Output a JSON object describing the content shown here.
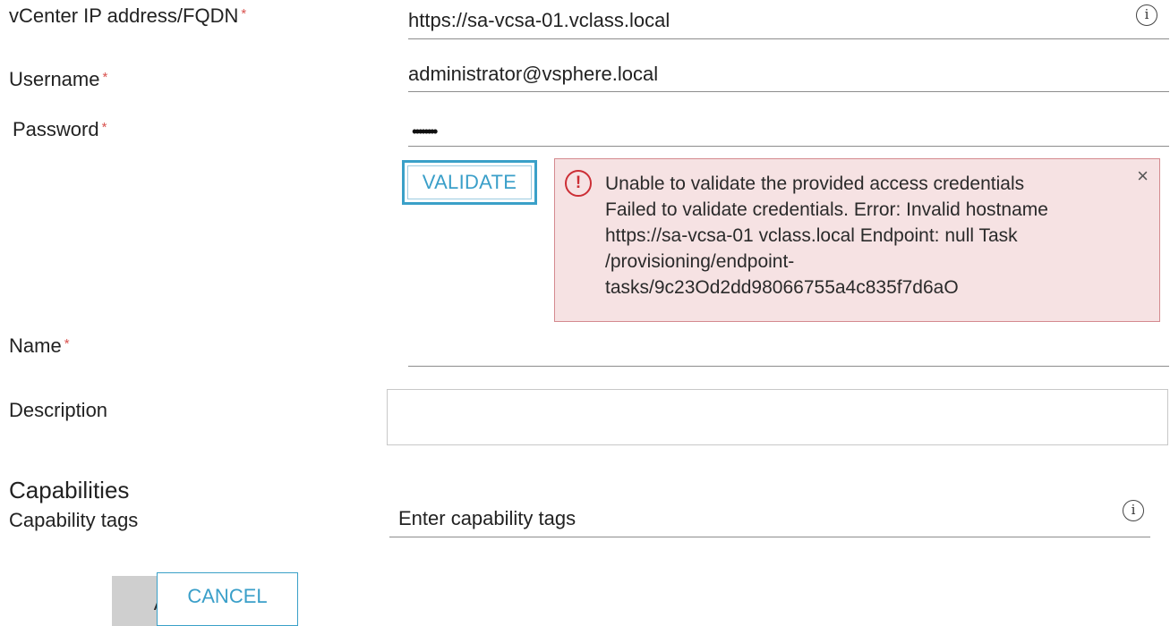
{
  "form": {
    "vcenter": {
      "label": "vCenter IP address/FQDN",
      "required_mark": "*",
      "value": "https://sa-vcsa-01.vclass.local",
      "info_icon": "info-icon"
    },
    "username": {
      "label": "Username",
      "required_mark": "*",
      "value": "administrator@vsphere.local"
    },
    "password": {
      "label": "Password",
      "required_mark": "*",
      "masked_value": "••••••••"
    },
    "validate_label": "VALIDATE",
    "alert": {
      "icon": "exclamation-icon",
      "lines": [
        "Unable to validate the provided access credentials",
        "Failed to validate credentials. Error: Invalid hostname",
        "https://sa-vcsa-01 vclass.local Endpoint: null Task",
        "/provisioning/endpoint-",
        "tasks/9c23Od2dd98066755a4c835f7d6aO"
      ],
      "close": "×"
    },
    "name": {
      "label": "Name",
      "required_mark": "*",
      "value": ""
    },
    "description": {
      "label": "Description",
      "value": ""
    },
    "capabilities": {
      "heading": "Capabilities",
      "tags_label": "Capability tags",
      "tags_placeholder": "Enter capability tags"
    },
    "actions": {
      "add_label": "ADD",
      "cancel_label": "CANCEL"
    }
  },
  "colors": {
    "accent": "#3aa0c8",
    "error": "#cc2e35",
    "error_bg": "#f6e2e3",
    "required": "#d9534f"
  }
}
